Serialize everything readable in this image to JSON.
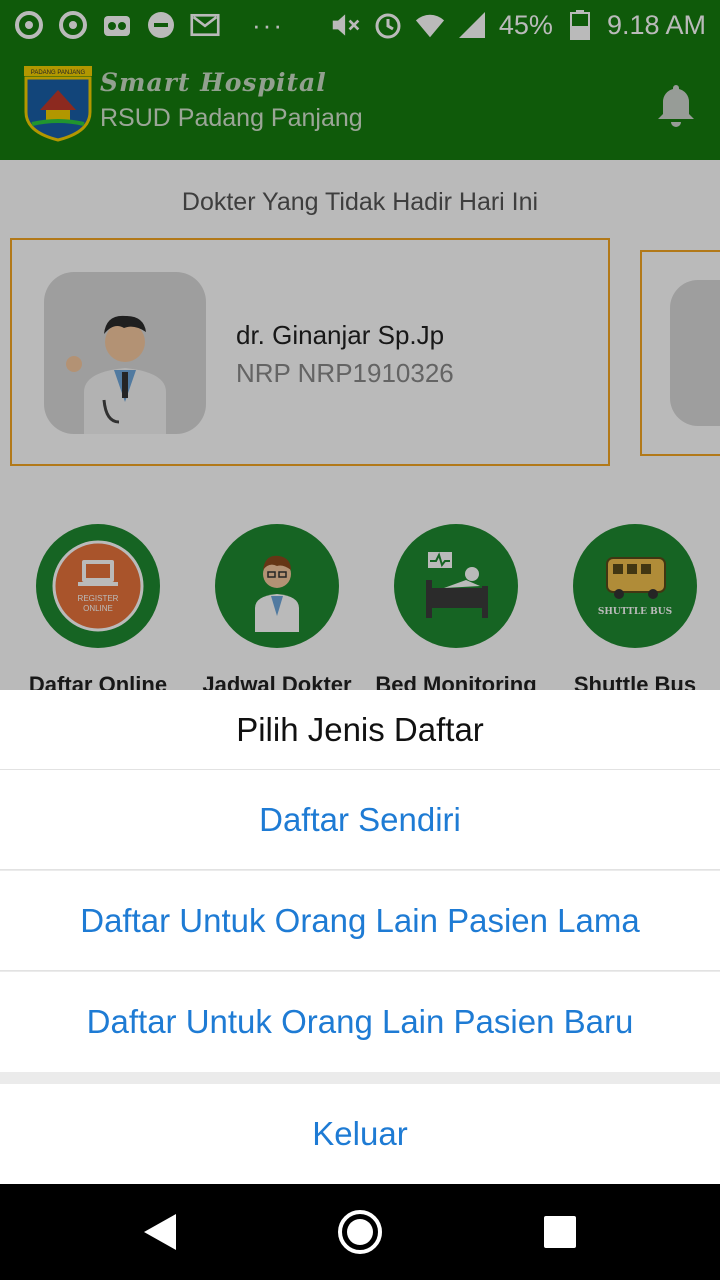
{
  "status_bar": {
    "battery": "45%",
    "time": "9.18 AM",
    "dots": "···",
    "icons": [
      "location-icon",
      "location-icon",
      "tripadvisor-icon",
      "do-not-disturb-icon",
      "gmail-icon",
      "mute-icon",
      "alarm-icon",
      "wifi-icon",
      "signal-icon",
      "battery-icon"
    ]
  },
  "header": {
    "subtitle": "Smart Hospital",
    "title": "RSUD Padang Panjang",
    "logo_text": "PADANG PANJANG",
    "notification_icon": "bell-icon"
  },
  "main": {
    "section_title": "Dokter Yang Tidak Hadir Hari Ini",
    "doctors": [
      {
        "name": "dr. Ginanjar Sp.Jp",
        "nrp": "NRP NRP1910326"
      }
    ],
    "menu": [
      {
        "label": "Daftar Online",
        "icon": "register-online-icon",
        "icon_text_1": "REGISTER",
        "icon_text_2": "ONLINE"
      },
      {
        "label": "Jadwal Dokter",
        "icon": "doctor-icon"
      },
      {
        "label": "Bed Monitoring",
        "icon": "bed-monitoring-icon"
      },
      {
        "label": "Shuttle Bus",
        "icon": "shuttle-bus-icon",
        "icon_text": "SHUTTLE BUS"
      }
    ]
  },
  "sheet": {
    "title": "Pilih Jenis Daftar",
    "options": [
      "Daftar Sendiri",
      "Daftar Untuk Orang Lain Pasien Lama",
      "Daftar Untuk Orang Lain Pasien Baru"
    ],
    "cancel": "Keluar"
  },
  "colors": {
    "primary_green": "#157c0f",
    "menu_green": "#1f8a30",
    "card_border": "#f5a623",
    "action_blue": "#1e7bd4"
  }
}
